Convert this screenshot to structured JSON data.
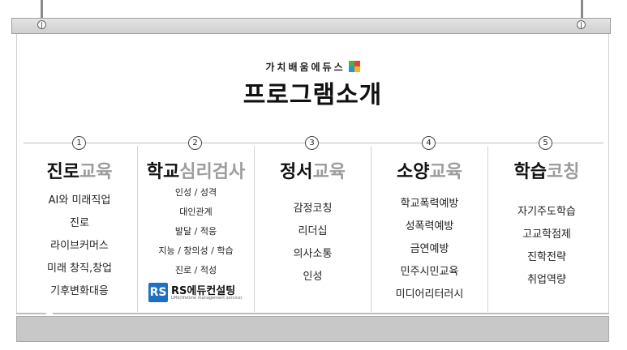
{
  "header": {
    "brand": "가치배움에듀스",
    "title": "프로그램소개"
  },
  "columns": [
    {
      "num": "1",
      "title_main": "진로",
      "title_sub": "교육",
      "items": [
        "AI와 미래직업",
        "진로",
        "라이브커머스",
        "미래 창직,창업",
        "기후변화대응"
      ]
    },
    {
      "num": "2",
      "title_main": "학교",
      "title_sub": "심리검사",
      "items": [
        "인성 / 성격",
        "대인관계",
        "발달 / 적응",
        "지능 / 창의성 / 학습",
        "진로 / 적성"
      ]
    },
    {
      "num": "3",
      "title_main": "정서",
      "title_sub": "교육",
      "items": [
        "감정코칭",
        "리더십",
        "의사소통",
        "인성"
      ]
    },
    {
      "num": "4",
      "title_main": "소양",
      "title_sub": "교육",
      "items": [
        "학교폭력예방",
        "성폭력예방",
        "금연예방",
        "민주시민교육",
        "미디어리터러시"
      ]
    },
    {
      "num": "5",
      "title_main": "학습",
      "title_sub": "코칭",
      "items": [
        "자기주도학습",
        "고교학점제",
        "진학전략",
        "취업역량"
      ]
    }
  ],
  "partner": {
    "mark": "RS",
    "name": "RS에듀컨설팅",
    "sub": "LMS(lifetime management service)"
  }
}
